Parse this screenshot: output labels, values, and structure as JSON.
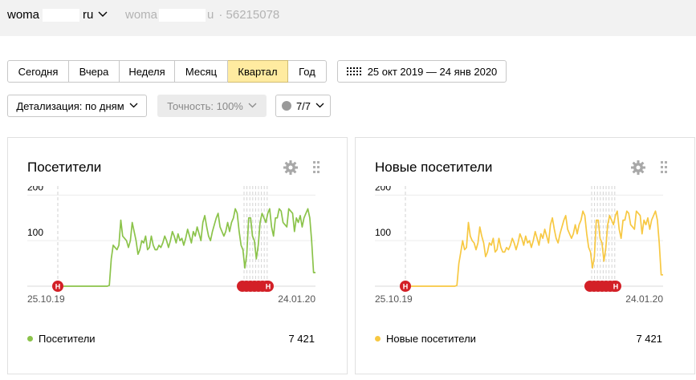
{
  "header": {
    "site_prefix": "woma",
    "site_suffix": "ru",
    "counter_prefix": "woma",
    "counter_suffix": "u",
    "counter_id": "· 56215078"
  },
  "period_tabs": [
    {
      "label": "Сегодня",
      "active": false
    },
    {
      "label": "Вчера",
      "active": false
    },
    {
      "label": "Неделя",
      "active": false
    },
    {
      "label": "Месяц",
      "active": false
    },
    {
      "label": "Квартал",
      "active": true
    },
    {
      "label": "Год",
      "active": false
    }
  ],
  "date_range": "25 окт 2019 — 24 янв 2020",
  "filters": {
    "detail": "Детализация: по дням",
    "accuracy": "Точность: 100%",
    "segments": "7/7"
  },
  "widgets": [
    {
      "title": "Посетители",
      "legend": "Посетители",
      "total": "7 421",
      "color": "#8bc34a",
      "start_label": "25.10.19",
      "end_label": "24.01.20",
      "annotation_label": "Н"
    },
    {
      "title": "Новые посетители",
      "legend": "Новые посетители",
      "total": "7 421",
      "color": "#f7c842",
      "start_label": "25.10.19",
      "end_label": "24.01.20",
      "annotation_label": "Н"
    }
  ],
  "chart_data": [
    {
      "type": "line",
      "title": "Посетители",
      "series": [
        {
          "name": "Посетители",
          "values": [
            0,
            0,
            0,
            0,
            0,
            0,
            0,
            0,
            0,
            0,
            0,
            0,
            0,
            0,
            0,
            0,
            0,
            0,
            0,
            0,
            0,
            0,
            0,
            0,
            0,
            0,
            0,
            2,
            60,
            90,
            85,
            80,
            90,
            145,
            110,
            105,
            100,
            85,
            100,
            140,
            120,
            100,
            70,
            80,
            100,
            95,
            110,
            80,
            85,
            110,
            90,
            80,
            80,
            90,
            85,
            95,
            110,
            100,
            85,
            100,
            120,
            110,
            95,
            115,
            100,
            105,
            90,
            105,
            125,
            110,
            95,
            120,
            110,
            130,
            115,
            100,
            140,
            155,
            130,
            110,
            100,
            120,
            135,
            150,
            160,
            130,
            120,
            110,
            120,
            140,
            120,
            140,
            150,
            170,
            160,
            120,
            90,
            80,
            40,
            70,
            150,
            150,
            110,
            100,
            60,
            90,
            140,
            160,
            150,
            140,
            160,
            170,
            130,
            110,
            150,
            150,
            170,
            165,
            140,
            135,
            130,
            170,
            165,
            160,
            120,
            150,
            140,
            155,
            130,
            150,
            160,
            170,
            150,
            100,
            30,
            30
          ]
        }
      ],
      "x_labels": [
        "25.10.19",
        "24.01.20"
      ],
      "y_ticks": [
        100,
        200
      ],
      "ylim": [
        0,
        220
      ]
    },
    {
      "type": "line",
      "title": "Новые посетители",
      "series": [
        {
          "name": "Новые посетители",
          "values": [
            0,
            0,
            0,
            0,
            0,
            0,
            0,
            0,
            0,
            0,
            0,
            0,
            0,
            0,
            0,
            0,
            0,
            0,
            0,
            0,
            0,
            0,
            0,
            0,
            0,
            0,
            0,
            2,
            50,
            75,
            100,
            80,
            85,
            140,
            110,
            100,
            95,
            80,
            95,
            130,
            110,
            95,
            65,
            75,
            95,
            90,
            105,
            75,
            80,
            105,
            85,
            75,
            75,
            85,
            80,
            90,
            105,
            95,
            80,
            95,
            115,
            105,
            90,
            110,
            95,
            100,
            85,
            100,
            120,
            105,
            90,
            115,
            105,
            125,
            110,
            95,
            135,
            150,
            125,
            105,
            95,
            115,
            130,
            145,
            155,
            125,
            115,
            105,
            115,
            135,
            115,
            135,
            145,
            165,
            155,
            115,
            85,
            75,
            40,
            65,
            145,
            145,
            105,
            95,
            55,
            85,
            135,
            155,
            145,
            135,
            155,
            165,
            125,
            105,
            145,
            145,
            165,
            160,
            135,
            130,
            125,
            165,
            160,
            155,
            115,
            145,
            135,
            150,
            125,
            145,
            155,
            165,
            145,
            95,
            25,
            25
          ]
        }
      ],
      "x_labels": [
        "25.10.19",
        "24.01.20"
      ],
      "y_ticks": [
        100,
        200
      ],
      "ylim": [
        0,
        220
      ]
    }
  ]
}
